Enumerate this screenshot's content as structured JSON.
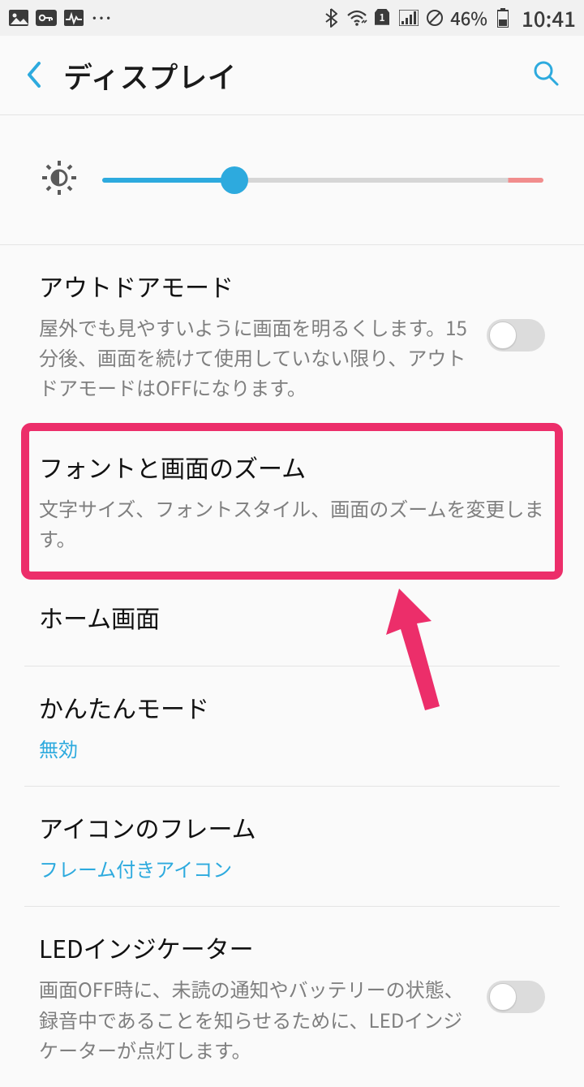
{
  "statusbar": {
    "battery_pct": "46%",
    "clock": "10:41"
  },
  "header": {
    "title": "ディスプレイ"
  },
  "brightness": {
    "value_pct": 30
  },
  "items": {
    "outdoor": {
      "title": "アウトドアモード",
      "sub": "屋外でも見やすいように画面を明るくします。15分後、画面を続けて使用していない限り、アウトドアモードはOFFになります。",
      "toggle": false
    },
    "font_zoom": {
      "title": "フォントと画面のズーム",
      "sub": "文字サイズ、フォントスタイル、画面のズームを変更します。"
    },
    "home": {
      "title": "ホーム画面"
    },
    "easy_mode": {
      "title": "かんたんモード",
      "sub": "無効"
    },
    "icon_frame": {
      "title": "アイコンのフレーム",
      "sub": "フレーム付きアイコン"
    },
    "led": {
      "title": "LEDインジケーター",
      "sub": "画面OFF時に、未読の通知やバッテリーの状態、録音中であることを知らせるために、LEDインジケーターが点灯します。",
      "toggle": false
    }
  },
  "annotation": {
    "highlight_color": "#ec2e6a"
  }
}
